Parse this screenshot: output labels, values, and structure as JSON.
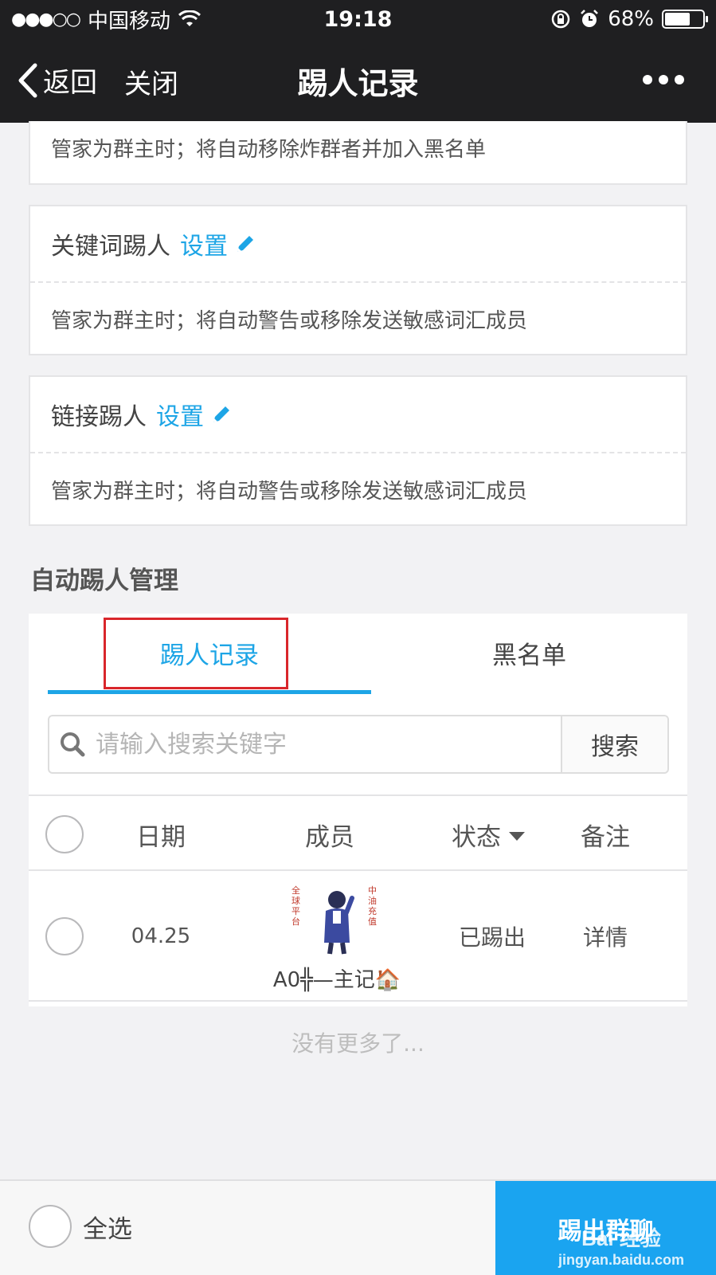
{
  "status_bar": {
    "signal": "●●●○○",
    "carrier": "中国移动",
    "time": "19:18",
    "battery_text": "68%",
    "battery_level": 0.68
  },
  "nav": {
    "back_label": "返回",
    "close_label": "关闭",
    "title": "踢人记录"
  },
  "cards": {
    "bomb_desc": "管家为群主时；将自动移除炸群者并加入黑名单",
    "keyword": {
      "title": "关键词踢人",
      "link": "设置",
      "desc": "管家为群主时；将自动警告或移除发送敏感词汇成员"
    },
    "link_kick": {
      "title": "链接踢人",
      "link": "设置",
      "desc": "管家为群主时；将自动警告或移除发送敏感词汇成员"
    }
  },
  "section_title": "自动踢人管理",
  "tabs": [
    {
      "label": "踢人记录",
      "active": true
    },
    {
      "label": "黑名单",
      "active": false
    }
  ],
  "search": {
    "placeholder": "请输入搜索关键字",
    "value": "",
    "button_label": "搜索"
  },
  "table": {
    "columns": [
      "日期",
      "成员",
      "状态",
      "备注"
    ],
    "rows": [
      {
        "date": "04.25",
        "avatar_text_left": "全球平台",
        "avatar_text_right": "中油充值",
        "member": "A0╬—主记🏠",
        "status": "已踢出",
        "note": "详情"
      }
    ]
  },
  "no_more": "没有更多了...",
  "footer": {
    "select_all": "全选",
    "action_label": "踢出群聊",
    "watermark_line1": "Bai 经验",
    "watermark_line2": "jingyan.baidu.com"
  },
  "colors": {
    "accent": "#1da5e6",
    "nav_bg": "#1f1f21",
    "highlight": "#d9262b",
    "action_bg": "#1aa4f0"
  }
}
